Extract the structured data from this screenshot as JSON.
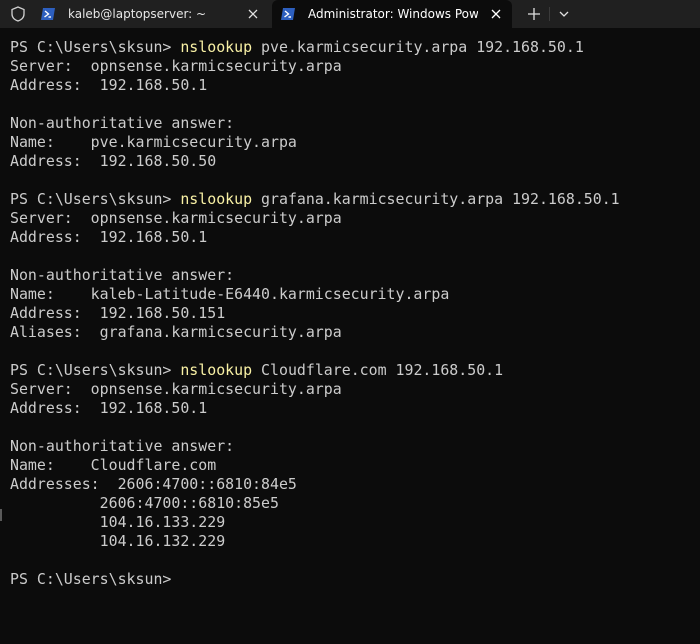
{
  "tabs": [
    {
      "title": "kaleb@laptopserver: ~",
      "active": false
    },
    {
      "title": "Administrator: Windows Powe",
      "active": true
    }
  ],
  "colors": {
    "background": "#0c0c0c",
    "text": "#cccccc",
    "command": "#f9f1a5",
    "tabbar": "#202020",
    "powershell_icon": "#2d5fbf"
  },
  "icons": {
    "shield": "shield-icon",
    "tab_app": "powershell-icon",
    "close": "close-icon",
    "new_tab": "plus-icon",
    "dropdown": "chevron-down-icon"
  },
  "terminal": {
    "lines": [
      {
        "prompt": "PS C:\\Users\\sksun> ",
        "cmd": "nslookup",
        "args": " pve.karmicsecurity.arpa 192.168.50.1"
      },
      {
        "text": "Server:  opnsense.karmicsecurity.arpa"
      },
      {
        "text": "Address:  192.168.50.1"
      },
      {
        "text": ""
      },
      {
        "text": "Non-authoritative answer:"
      },
      {
        "text": "Name:    pve.karmicsecurity.arpa"
      },
      {
        "text": "Address:  192.168.50.50"
      },
      {
        "text": ""
      },
      {
        "prompt": "PS C:\\Users\\sksun> ",
        "cmd": "nslookup",
        "args": " grafana.karmicsecurity.arpa 192.168.50.1"
      },
      {
        "text": "Server:  opnsense.karmicsecurity.arpa"
      },
      {
        "text": "Address:  192.168.50.1"
      },
      {
        "text": ""
      },
      {
        "text": "Non-authoritative answer:"
      },
      {
        "text": "Name:    kaleb-Latitude-E6440.karmicsecurity.arpa"
      },
      {
        "text": "Address:  192.168.50.151"
      },
      {
        "text": "Aliases:  grafana.karmicsecurity.arpa"
      },
      {
        "text": ""
      },
      {
        "prompt": "PS C:\\Users\\sksun> ",
        "cmd": "nslookup",
        "args": " Cloudflare.com 192.168.50.1"
      },
      {
        "text": "Server:  opnsense.karmicsecurity.arpa"
      },
      {
        "text": "Address:  192.168.50.1"
      },
      {
        "text": ""
      },
      {
        "text": "Non-authoritative answer:"
      },
      {
        "text": "Name:    Cloudflare.com"
      },
      {
        "text": "Addresses:  2606:4700::6810:84e5"
      },
      {
        "text": "          2606:4700::6810:85e5"
      },
      {
        "text": "          104.16.133.229"
      },
      {
        "text": "          104.16.132.229"
      },
      {
        "text": ""
      },
      {
        "prompt": "PS C:\\Users\\sksun>",
        "cmd": "",
        "args": ""
      }
    ]
  }
}
